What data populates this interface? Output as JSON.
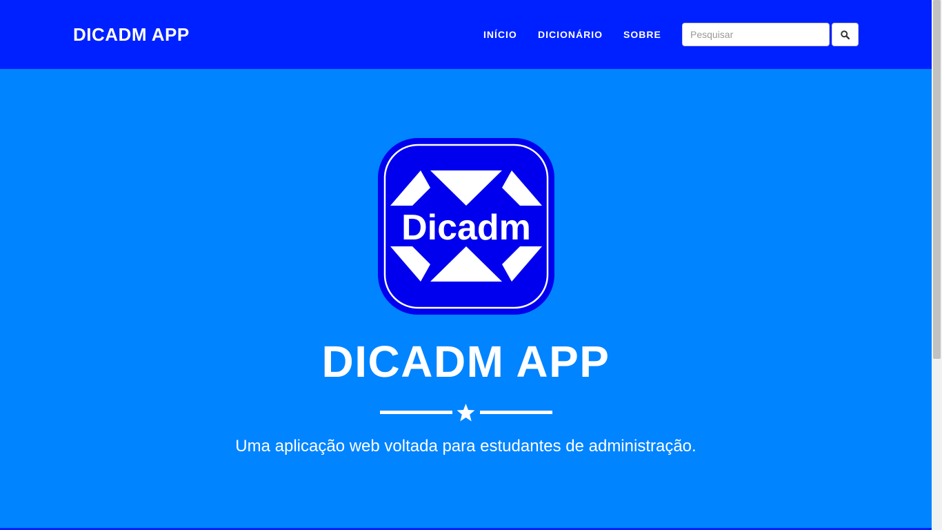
{
  "colors": {
    "navbar_bg": "#0021ff",
    "hero_bg": "#0084ff",
    "logo_blue": "#0000ee",
    "text": "#ffffff"
  },
  "navbar": {
    "brand": "DICADM APP",
    "links": [
      {
        "label": "INÍCIO"
      },
      {
        "label": "DICIONÁRIO"
      },
      {
        "label": "SOBRE"
      }
    ],
    "search": {
      "placeholder": "Pesquisar",
      "button_icon": "search-icon"
    }
  },
  "hero": {
    "logo": {
      "text": "Dicadm",
      "icon": "dicadm-logo-icon"
    },
    "title": "DICADM APP",
    "divider_icon": "star-icon",
    "tagline": "Uma aplicação web voltada para estudantes de administração."
  }
}
